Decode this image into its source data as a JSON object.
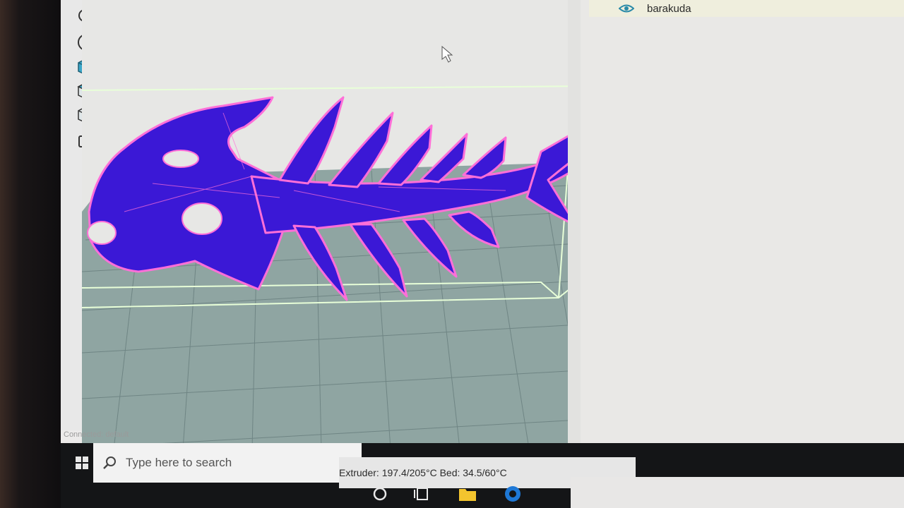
{
  "viewport": {
    "colors": {
      "model_fill": "#3b18d6",
      "model_edge": "#ff6fd8",
      "bed": "#8fa5a2",
      "grid": "#6f8584",
      "volume": "#e8ffd8"
    }
  },
  "toolbar": {
    "icons": [
      "zoom-in-icon",
      "fit-view-icon",
      "view-cube-front-icon",
      "view-cube-top-icon",
      "view-cube-side-icon",
      "layers-icon"
    ]
  },
  "objects_panel": {
    "items": [
      {
        "name": "barakuda",
        "visible_icon": "eye-icon"
      }
    ]
  },
  "status_bar": {
    "connection": "Connected: default",
    "extruder_bed": "Extruder: 197.4/205°C Bed: 34.5/60°C"
  },
  "taskbar": {
    "search_placeholder": "Type here to search",
    "icons": [
      "windows-start-icon",
      "search-icon",
      "cortana-icon",
      "task-view-icon",
      "file-explorer-icon",
      "browser-icon"
    ]
  }
}
